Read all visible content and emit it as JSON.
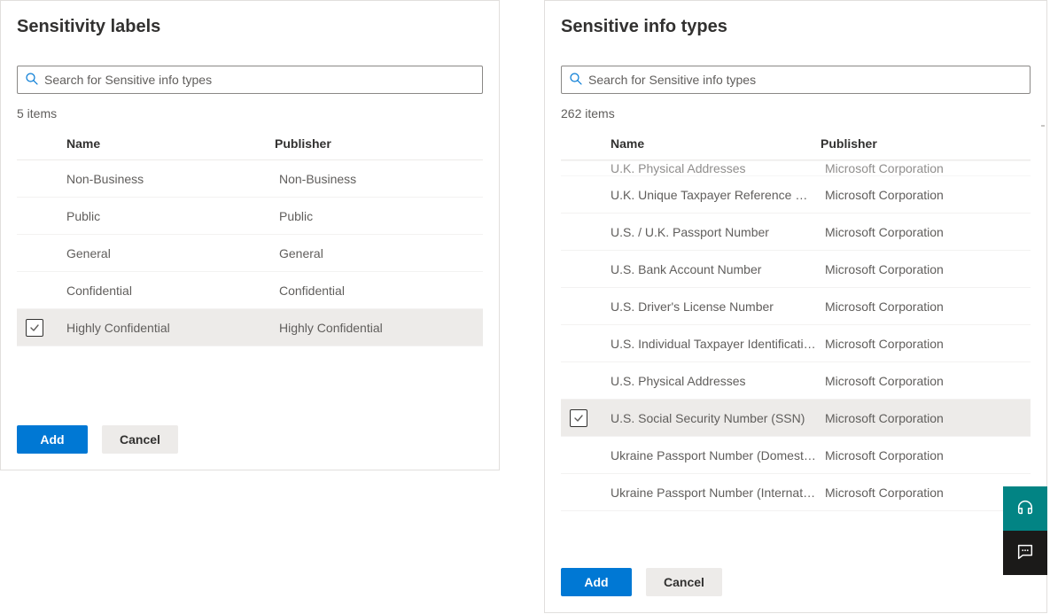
{
  "leftPanel": {
    "title": "Sensitivity labels",
    "searchPlaceholder": "Search for Sensitive info types",
    "itemCount": "5 items",
    "columns": {
      "name": "Name",
      "publisher": "Publisher"
    },
    "rows": [
      {
        "name": "Non-Business",
        "publisher": "Non-Business",
        "selected": false
      },
      {
        "name": "Public",
        "publisher": "Public",
        "selected": false
      },
      {
        "name": "General",
        "publisher": "General",
        "selected": false
      },
      {
        "name": "Confidential",
        "publisher": "Confidential",
        "selected": false
      },
      {
        "name": "Highly Confidential",
        "publisher": "Highly Confidential",
        "selected": true
      }
    ],
    "addLabel": "Add",
    "cancelLabel": "Cancel"
  },
  "rightPanel": {
    "title": "Sensitive info types",
    "searchPlaceholder": "Search for Sensitive info types",
    "itemCount": "262 items",
    "columns": {
      "name": "Name",
      "publisher": "Publisher"
    },
    "partialTopRow": {
      "name": "U.K. Physical Addresses",
      "publisher": "Microsoft Corporation"
    },
    "rows": [
      {
        "name": "U.K. Unique Taxpayer Reference Number",
        "publisher": "Microsoft Corporation",
        "selected": false
      },
      {
        "name": "U.S. / U.K. Passport Number",
        "publisher": "Microsoft Corporation",
        "selected": false
      },
      {
        "name": "U.S. Bank Account Number",
        "publisher": "Microsoft Corporation",
        "selected": false
      },
      {
        "name": "U.S. Driver's License Number",
        "publisher": "Microsoft Corporation",
        "selected": false
      },
      {
        "name": "U.S. Individual Taxpayer Identification N...",
        "publisher": "Microsoft Corporation",
        "selected": false
      },
      {
        "name": "U.S. Physical Addresses",
        "publisher": "Microsoft Corporation",
        "selected": false
      },
      {
        "name": "U.S. Social Security Number (SSN)",
        "publisher": "Microsoft Corporation",
        "selected": true
      },
      {
        "name": "Ukraine Passport Number (Domestic)",
        "publisher": "Microsoft Corporation",
        "selected": false
      },
      {
        "name": "Ukraine Passport Number (International)",
        "publisher": "Microsoft Corporation",
        "selected": false
      }
    ],
    "addLabel": "Add",
    "cancelLabel": "Cancel"
  }
}
